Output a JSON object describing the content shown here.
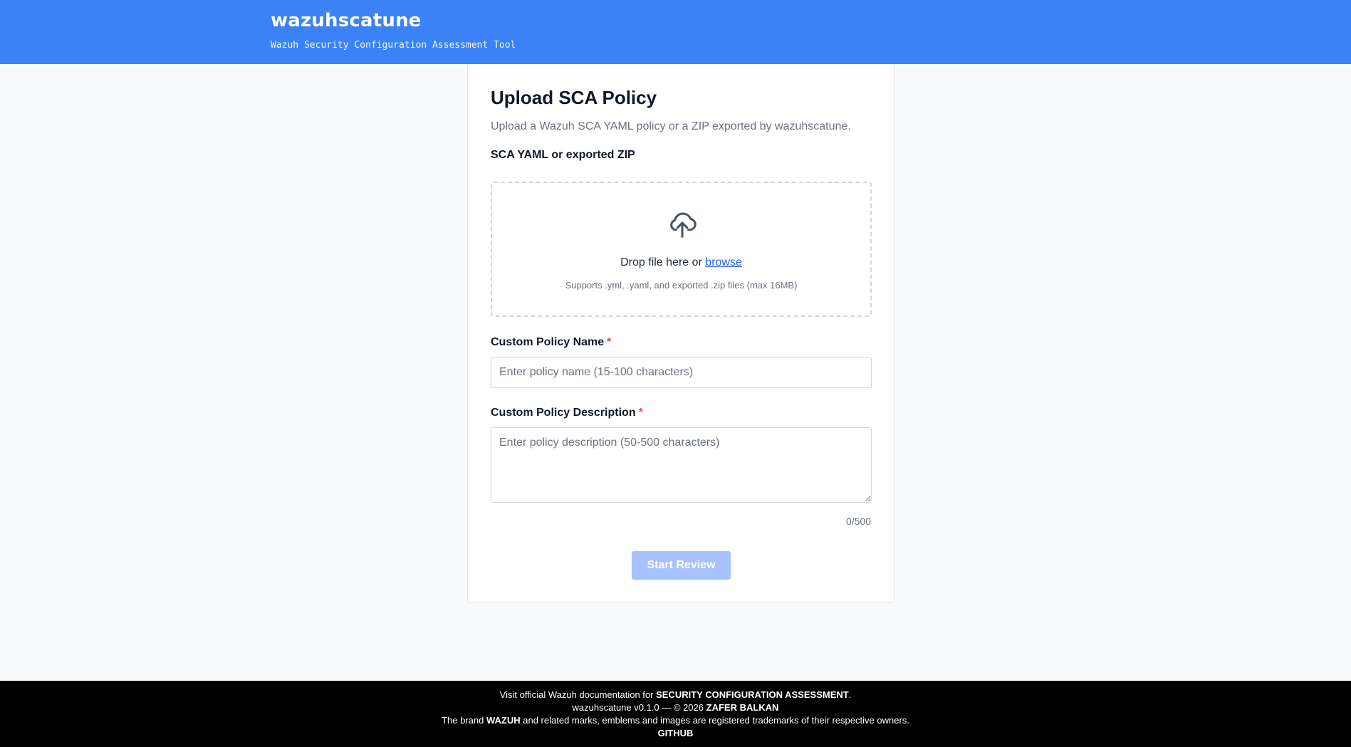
{
  "header": {
    "title": "wazuhscatune",
    "subtitle": "Wazuh Security Configuration Assessment Tool"
  },
  "card": {
    "title": "Upload SCA Policy",
    "description": "Upload a Wazuh SCA YAML policy or a ZIP exported by wazuhscatune."
  },
  "upload": {
    "label": "SCA YAML or exported ZIP",
    "icon": "cloud-upload-icon",
    "drop_text": "Drop file here or ",
    "browse_label": "browse",
    "hint": "Supports .yml, .yaml, and exported .zip files (max 16MB)"
  },
  "policy_name": {
    "label": "Custom Policy Name",
    "required_mark": "*",
    "placeholder": "Enter policy name (15-100 characters)",
    "value": ""
  },
  "policy_description": {
    "label": "Custom Policy Description",
    "required_mark": "*",
    "placeholder": "Enter policy description (50-500 characters)",
    "value": "",
    "counter": "0/500"
  },
  "actions": {
    "start_review_label": "Start Review",
    "start_review_disabled": true
  },
  "footer": {
    "line1_prefix": "Visit official Wazuh documentation for ",
    "line1_link": "SECURITY CONFIGURATION ASSESSMENT",
    "line1_suffix": ".",
    "line2_prefix": "wazuhscatune v0.1.0 — © 2026 ",
    "line2_author": "ZAFER BALKAN",
    "line3_prefix": "The brand ",
    "line3_brand": "WAZUH",
    "line3_suffix": " and related marks, emblems and images are registered trademarks of their respective owners.",
    "github_label": "GITHUB"
  },
  "colors": {
    "header_bg": "#3b82f6",
    "accent_link": "#2563eb",
    "required": "#ef4444",
    "button_disabled": "#a7c2fa",
    "footer_bg": "#000000"
  }
}
